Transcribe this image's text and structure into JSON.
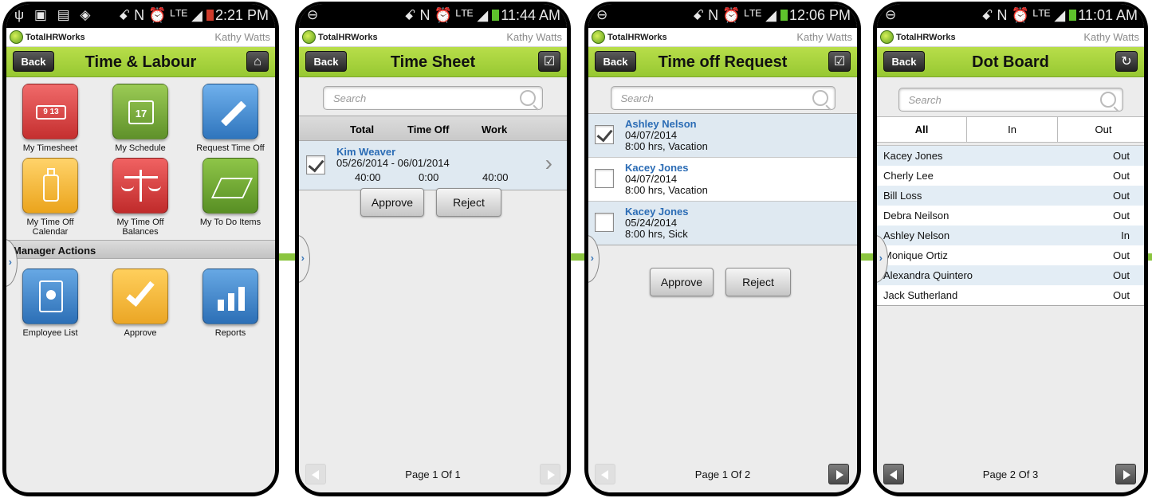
{
  "status_icons_left": "ψ ▣ ▤ ◈",
  "status_icons_right": "ꗃ N ⏰ ᴸᵀᴱ ◢",
  "phones": [
    {
      "time": "2:21 PM"
    },
    {
      "time": "11:44 AM"
    },
    {
      "time": "12:06 PM"
    },
    {
      "time": "11:01 AM"
    }
  ],
  "app": {
    "brand": "TotalHRWorks",
    "user": "Kathy Watts",
    "back_label": "Back"
  },
  "screen1": {
    "title": "Time & Labour",
    "tiles": [
      {
        "label": "My Timesheet",
        "icon": "timesheet-icon",
        "color": "#d63b3b"
      },
      {
        "label": "My Schedule",
        "icon": "calendar-icon",
        "color": "#7bab3a",
        "glyph": "17"
      },
      {
        "label": "Request Time Off",
        "icon": "pencil-icon",
        "color": "#3f89cf"
      },
      {
        "label": "My Time Off Calendar",
        "icon": "luggage-icon",
        "color": "#f2b22b"
      },
      {
        "label": "My Time Off Balances",
        "icon": "scales-icon",
        "color": "#cf3a3a"
      },
      {
        "label": "My To Do Items",
        "icon": "clipboard-icon",
        "color": "#6ca52f"
      }
    ],
    "section": "Manager Actions",
    "manager_tiles": [
      {
        "label": "Employee List",
        "icon": "contacts-book-icon",
        "color": "#3a86cf"
      },
      {
        "label": "Approve",
        "icon": "checkmark-icon",
        "color": "#f2b42c"
      },
      {
        "label": "Reports",
        "icon": "bar-chart-icon",
        "color": "#3a86cf"
      }
    ]
  },
  "screen2": {
    "title": "Time Sheet",
    "search_placeholder": "Search",
    "headers": [
      "Total",
      "Time Off",
      "Work"
    ],
    "row": {
      "name": "Kim Weaver",
      "range": "05/26/2014 - 06/01/2014",
      "total": "40:00",
      "time_off": "0:00",
      "work": "40:00",
      "checked": true
    },
    "approve": "Approve",
    "reject": "Reject",
    "page": "Page 1 Of 1"
  },
  "screen3": {
    "title": "Time off Request",
    "search_placeholder": "Search",
    "requests": [
      {
        "name": "Ashley Nelson",
        "date": "04/07/2014",
        "detail": "8:00 hrs, Vacation",
        "checked": true
      },
      {
        "name": "Kacey Jones",
        "date": "04/07/2014",
        "detail": "8:00 hrs, Vacation",
        "checked": false
      },
      {
        "name": "Kacey Jones",
        "date": "05/24/2014",
        "detail": "8:00 hrs, Sick",
        "checked": false
      }
    ],
    "approve": "Approve",
    "reject": "Reject",
    "page": "Page 1 Of 2"
  },
  "screen4": {
    "title": "Dot Board",
    "search_placeholder": "Search",
    "segments": [
      "All",
      "In",
      "Out"
    ],
    "people": [
      {
        "name": "Kacey Jones",
        "status": "Out"
      },
      {
        "name": "Cherly Lee",
        "status": "Out"
      },
      {
        "name": "Bill Loss",
        "status": "Out"
      },
      {
        "name": "Debra Neilson",
        "status": "Out"
      },
      {
        "name": "Ashley Nelson",
        "status": "In"
      },
      {
        "name": "Monique Ortiz",
        "status": "Out"
      },
      {
        "name": "Alexandra Quintero",
        "status": "Out"
      },
      {
        "name": "Jack Sutherland",
        "status": "Out"
      }
    ],
    "page": "Page 2 Of 3"
  }
}
